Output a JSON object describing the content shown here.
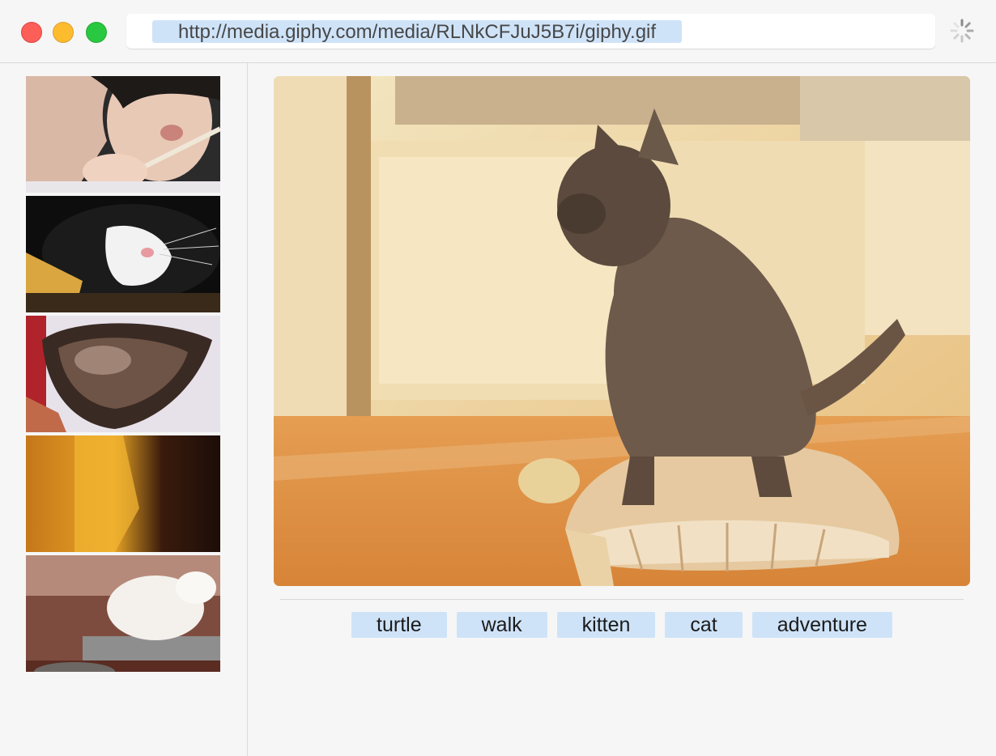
{
  "window": {
    "traffic_lights": [
      "close-button",
      "minimize-button",
      "zoom-button"
    ],
    "address_bar": {
      "url": "http://media.giphy.com/media/RLNkCFJuJ5B7i/giphy.gif"
    },
    "loading_indicator": "spinner-icon"
  },
  "sidebar": {
    "thumbnails": [
      {
        "subject": "person-eating-with-chopsticks"
      },
      {
        "subject": "black-and-white-cat"
      },
      {
        "subject": "hedgehog-closeup"
      },
      {
        "subject": "blurred-orange-scene"
      },
      {
        "subject": "white-puppy-on-table"
      }
    ]
  },
  "main": {
    "image_subject": "kitten-riding-turtle",
    "tags": [
      "turtle",
      "walk",
      "kitten",
      "cat",
      "adventure"
    ]
  },
  "colors": {
    "window_bg": "#f6f6f6",
    "tag_bg": "#cfe3f8",
    "url_highlight": "#cfe3f8",
    "close": "#fc5f57",
    "minimize": "#fdbc2e",
    "zoom": "#28c840"
  }
}
